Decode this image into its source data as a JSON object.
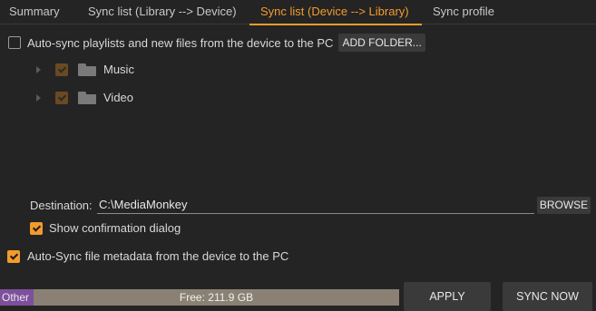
{
  "tabs": [
    {
      "label": "Summary"
    },
    {
      "label": "Sync list (Library --> Device)"
    },
    {
      "label": "Sync list (Device --> Library)"
    },
    {
      "label": "Sync profile"
    }
  ],
  "active_tab": "Sync list (Device --> Library)",
  "auto_sync": {
    "label": "Auto-sync playlists and new files from the device to the PC",
    "checked": false,
    "add_folder_label": "ADD FOLDER..."
  },
  "folders": [
    {
      "name": "Music",
      "checked": true
    },
    {
      "name": "Video",
      "checked": true
    }
  ],
  "destination": {
    "label": "Destination:",
    "value": "C:\\MediaMonkey",
    "browse_label": "BROWSE"
  },
  "show_confirmation": {
    "label": "Show confirmation dialog",
    "checked": true
  },
  "metadata_sync": {
    "label": "Auto-Sync file metadata from the device to the PC",
    "checked": true
  },
  "storage": {
    "other_label": "Other",
    "free_label": "Free: 211.9 GB",
    "other_fraction": 0.084
  },
  "buttons": {
    "apply": "APPLY",
    "sync_now": "SYNC NOW"
  },
  "colors": {
    "accent": "#f29b2c",
    "background": "#242424",
    "other_segment": "#7d4f9c",
    "free_segment": "#8a8174"
  }
}
